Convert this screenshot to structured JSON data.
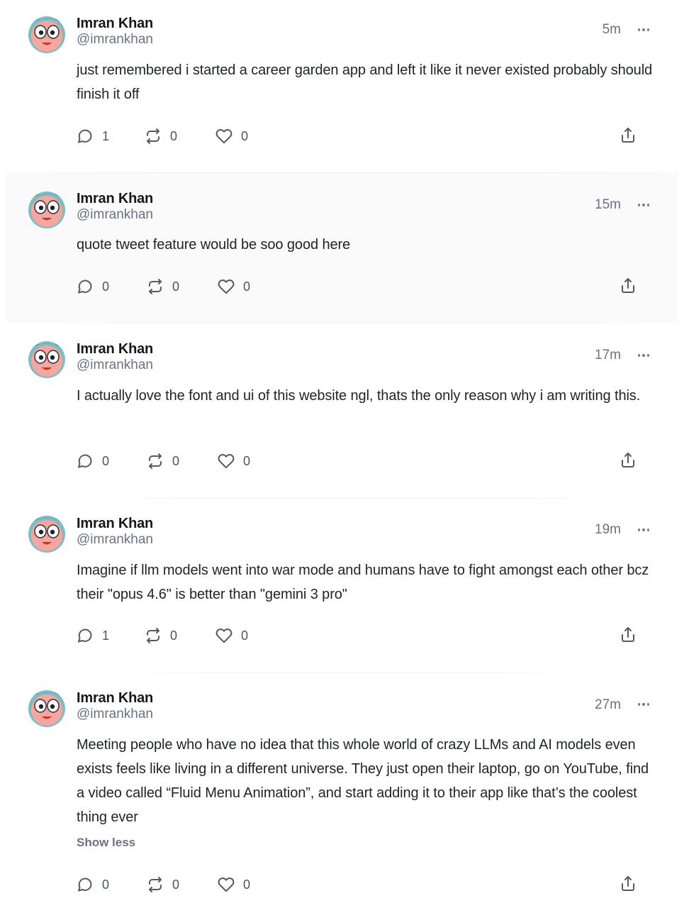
{
  "icons": {
    "reply": "reply-icon",
    "repost": "repost-icon",
    "like": "heart-icon",
    "share": "share-icon",
    "more": "more-icon"
  },
  "colors": {
    "icon": "#555b64",
    "muted": "#6b7280",
    "hover_bg": "#fafafa"
  },
  "posts": [
    {
      "name": "Imran Khan",
      "handle": "@imrankhan",
      "time": "5m",
      "text": "just remembered i started a career garden app and left it like it never existed probably should finish it off",
      "replies": "1",
      "reposts": "0",
      "likes": "0"
    },
    {
      "name": "Imran Khan",
      "handle": "@imrankhan",
      "time": "15m",
      "text": "quote tweet feature would be soo good here",
      "replies": "0",
      "reposts": "0",
      "likes": "0"
    },
    {
      "name": "Imran Khan",
      "handle": "@imrankhan",
      "time": "17m",
      "text": "I actually love the font and ui of this website ngl, thats the only reason why i am writing this.",
      "replies": "0",
      "reposts": "0",
      "likes": "0"
    },
    {
      "name": "Imran Khan",
      "handle": "@imrankhan",
      "time": "19m",
      "text": "Imagine if llm models went into war mode and humans have to fight amongst each other bcz their \"opus 4.6\" is better than \"gemini 3 pro\"",
      "replies": "1",
      "reposts": "0",
      "likes": "0"
    },
    {
      "name": "Imran Khan",
      "handle": "@imrankhan",
      "time": "27m",
      "text": "Meeting people who have no idea that this whole world of crazy LLMs and AI models even exists feels like living in a different universe. They just open their laptop, go on YouTube, find a video called “Fluid Menu Animation”, and start adding it to their app like that’s the coolest thing ever",
      "show_less": "Show less",
      "replies": "0",
      "reposts": "0",
      "likes": "0"
    }
  ]
}
